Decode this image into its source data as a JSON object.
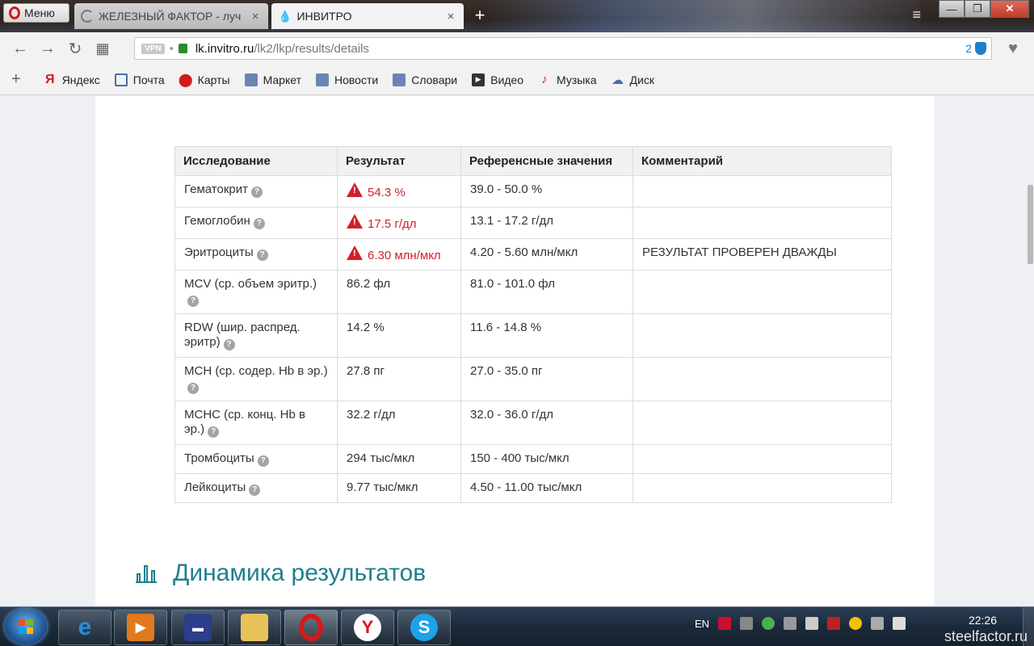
{
  "browser": {
    "menu_label": "Меню",
    "tabs": [
      {
        "label": "ЖЕЛЕЗНЫЙ ФАКТОР - луч",
        "active": false
      },
      {
        "label": "ИНВИТРО",
        "active": true
      }
    ],
    "close_glyph": "×",
    "new_tab_glyph": "+",
    "url": {
      "vpn": "VPN",
      "dot": "•",
      "host": "lk.invitro.ru",
      "path": "/lk2/lkp/results/details",
      "blocked_count": "2"
    }
  },
  "bookmarks": [
    {
      "label": "Яндекс",
      "icon": "yandex-icon"
    },
    {
      "label": "Почта",
      "icon": "mail-icon"
    },
    {
      "label": "Карты",
      "icon": "map-pin-icon"
    },
    {
      "label": "Маркет",
      "icon": "market-icon"
    },
    {
      "label": "Новости",
      "icon": "news-icon"
    },
    {
      "label": "Словари",
      "icon": "dictionary-icon"
    },
    {
      "label": "Видео",
      "icon": "video-icon"
    },
    {
      "label": "Музыка",
      "icon": "music-icon"
    },
    {
      "label": "Диск",
      "icon": "disk-icon"
    }
  ],
  "results_table": {
    "headers": [
      "Исследование",
      "Результат",
      "Референсные значения",
      "Комментарий"
    ],
    "help_glyph": "?",
    "rows": [
      {
        "test": "Гематокрит",
        "result": "54.3 %",
        "reference": "39.0 - 50.0 %",
        "comment": "",
        "flagged": true
      },
      {
        "test": "Гемоглобин",
        "result": "17.5 г/дл",
        "reference": "13.1 - 17.2 г/дл",
        "comment": "",
        "flagged": true
      },
      {
        "test": "Эритроциты",
        "result": "6.30 млн/мкл",
        "reference": "4.20 - 5.60 млн/мкл",
        "comment": "РЕЗУЛЬТАТ ПРОВЕРЕН ДВАЖДЫ",
        "flagged": true
      },
      {
        "test": "MCV (ср. объем эритр.)",
        "result": "86.2 фл",
        "reference": "81.0 - 101.0 фл",
        "comment": "",
        "flagged": false
      },
      {
        "test": "RDW (шир. распред. эритр)",
        "result": "14.2 %",
        "reference": "11.6 - 14.8 %",
        "comment": "",
        "flagged": false
      },
      {
        "test": "MCH (ср. содер. Hb в эр.)",
        "result": "27.8 пг",
        "reference": "27.0 - 35.0 пг",
        "comment": "",
        "flagged": false
      },
      {
        "test": "MCHC (ср. конц. Hb в эр.)",
        "result": "32.2 г/дл",
        "reference": "32.0 - 36.0 г/дл",
        "comment": "",
        "flagged": false
      },
      {
        "test": "Тромбоциты",
        "result": "294 тыс/мкл",
        "reference": "150 - 400 тыс/мкл",
        "comment": "",
        "flagged": false
      },
      {
        "test": "Лейкоциты",
        "result": "9.77 тыс/мкл",
        "reference": "4.50 - 11.00 тыс/мкл",
        "comment": "",
        "flagged": false
      }
    ]
  },
  "dynamics_title": "Динамика результатов",
  "taskbar": {
    "lang": "EN",
    "time": "22:26",
    "watermark": "steelfactor.ru"
  },
  "colors": {
    "accent": "#1e7f8f",
    "flag": "#d0202a"
  }
}
